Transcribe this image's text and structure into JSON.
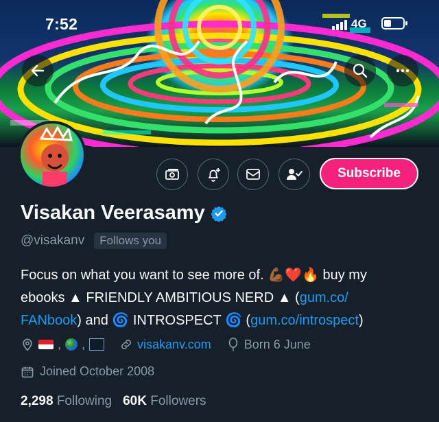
{
  "status_bar": {
    "time": "7:52",
    "network": "4G"
  },
  "profile": {
    "name": "Visakan Veerasamy",
    "handle": "@visakanv",
    "follows_you": "Follows you",
    "subscribe_label": "Subscribe",
    "bio": {
      "line1_text": "Focus on what you want to see more of.",
      "line1_after": "buy my",
      "line2_a": "ebooks ▲ FRIENDLY AMBITIOUS NERD ▲ (",
      "line2_link": "gum.co/",
      "line3_link": "FANbook",
      "line3_b": ") and 🌀 INTROSPECT 🌀 (",
      "line3_link2": "gum.co/introspect",
      "line3_c": ")"
    },
    "meta": {
      "location_sep1": ",",
      "location_sep2": ",",
      "website": "visakanv.com",
      "born": "Born 6 June"
    },
    "joined": "Joined October 2008",
    "stats": {
      "following_count": "2,298",
      "following_label": "Following",
      "followers_count": "60K",
      "followers_label": "Followers"
    }
  },
  "icons": {
    "back": "arrow-left-icon",
    "search": "search-icon",
    "more": "more-icon",
    "tips": "money-icon",
    "notify": "bell-plus-icon",
    "message": "mail-icon",
    "following": "user-check-icon",
    "verified": "verified-badge-icon",
    "location": "location-pin-icon",
    "link": "link-icon",
    "birthday": "balloon-icon",
    "calendar": "calendar-icon"
  },
  "colors": {
    "accent": "#1d9bf0",
    "subscribe": "#f4227d",
    "background": "#15202b"
  }
}
